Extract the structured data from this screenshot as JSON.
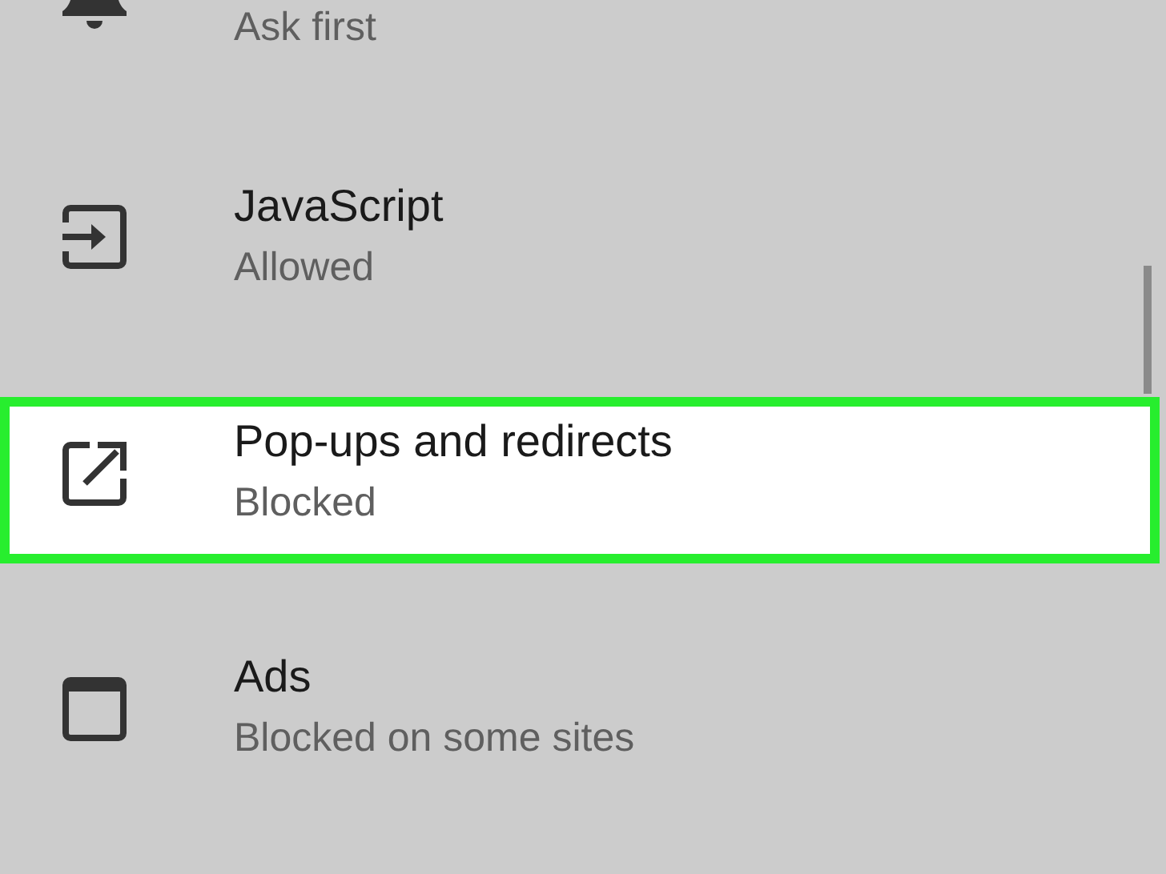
{
  "settings_items": [
    {
      "subtitle": "Ask first",
      "selected": false
    },
    {
      "title": "JavaScript",
      "subtitle": "Allowed",
      "selected": false
    },
    {
      "title": "Pop-ups and redirects",
      "subtitle": "Blocked",
      "selected": true
    },
    {
      "title": "Ads",
      "subtitle": "Blocked on some sites",
      "selected": false
    }
  ]
}
